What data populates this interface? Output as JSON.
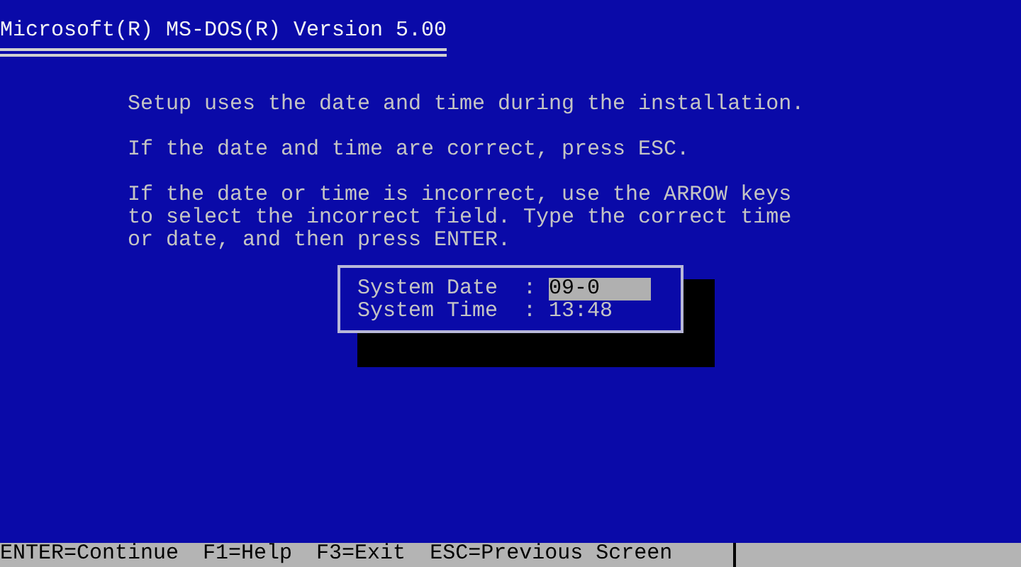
{
  "title": "Microsoft(R) MS-DOS(R) Version 5.00",
  "paragraphs": [
    "Setup uses the date and time during the installation.",
    "If the date and time are correct, press ESC.",
    "If the date or time is incorrect, use the ARROW keys\nto select the incorrect field. Type the correct time\nor date, and then press ENTER."
  ],
  "fields": [
    {
      "label": "System Date",
      "separator": ":",
      "value": "09-0",
      "selected": true
    },
    {
      "label": "System Time",
      "separator": ":",
      "value": "13:48",
      "selected": false
    }
  ],
  "status_bar": [
    "ENTER=Continue",
    "F1=Help",
    "F3=Exit",
    "ESC=Previous Screen"
  ]
}
